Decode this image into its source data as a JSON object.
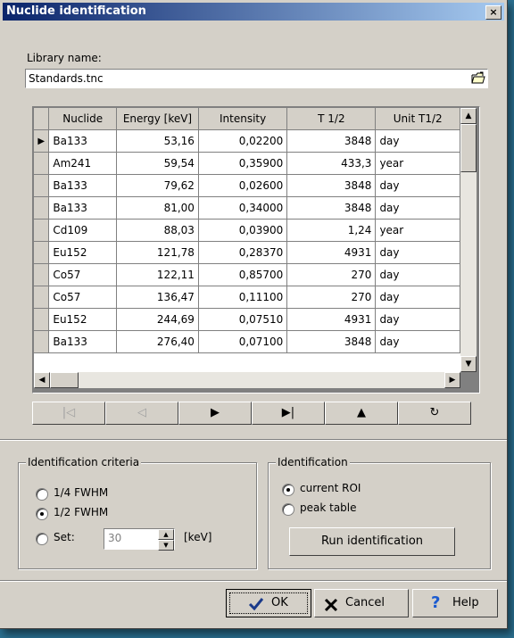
{
  "window": {
    "title": "Nuclide identification",
    "close_glyph": "×"
  },
  "library": {
    "label": "Library name:",
    "value": "Standards.tnc",
    "open_icon": "open-file-icon"
  },
  "table": {
    "columns": [
      "Nuclide",
      "Energy [keV]",
      "Intensity",
      "T 1/2",
      "Unit T1/2"
    ],
    "rows": [
      [
        "Ba133",
        "53,16",
        "0,02200",
        "3848",
        "day"
      ],
      [
        "Am241",
        "59,54",
        "0,35900",
        "433,3",
        "year"
      ],
      [
        "Ba133",
        "79,62",
        "0,02600",
        "3848",
        "day"
      ],
      [
        "Ba133",
        "81,00",
        "0,34000",
        "3848",
        "day"
      ],
      [
        "Cd109",
        "88,03",
        "0,03900",
        "1,24",
        "year"
      ],
      [
        "Eu152",
        "121,78",
        "0,28370",
        "4931",
        "day"
      ],
      [
        "Co57",
        "122,11",
        "0,85700",
        "270",
        "day"
      ],
      [
        "Co57",
        "136,47",
        "0,11100",
        "270",
        "day"
      ],
      [
        "Eu152",
        "244,69",
        "0,07510",
        "4931",
        "day"
      ],
      [
        "Ba133",
        "276,40",
        "0,07100",
        "3848",
        "day"
      ]
    ],
    "current_row_marker": "▶"
  },
  "navigator": [
    {
      "icon": "first-record-icon",
      "glyph": "|◁",
      "enabled": false
    },
    {
      "icon": "prior-record-icon",
      "glyph": "◁",
      "enabled": false
    },
    {
      "icon": "next-record-icon",
      "glyph": "▶",
      "enabled": true
    },
    {
      "icon": "last-record-icon",
      "glyph": "▶|",
      "enabled": true
    },
    {
      "icon": "up-icon",
      "glyph": "▲",
      "enabled": true
    },
    {
      "icon": "refresh-icon",
      "glyph": "↻",
      "enabled": true
    }
  ],
  "criteria": {
    "title": "Identification criteria",
    "options": [
      "1/4 FWHM",
      "1/2 FWHM",
      "Set:"
    ],
    "selected": "1/2 FWHM",
    "set_value": "30",
    "unit": "[keV]"
  },
  "identification": {
    "title": "Identification",
    "options": [
      "current ROI",
      "peak table"
    ],
    "selected": "current ROI",
    "run_label": "Run identification"
  },
  "buttons": {
    "ok": "OK",
    "cancel": "Cancel",
    "help": "Help"
  },
  "colors": {
    "title_start": "#0a246a",
    "title_end": "#a6caf0",
    "face": "#d4d0c8"
  }
}
